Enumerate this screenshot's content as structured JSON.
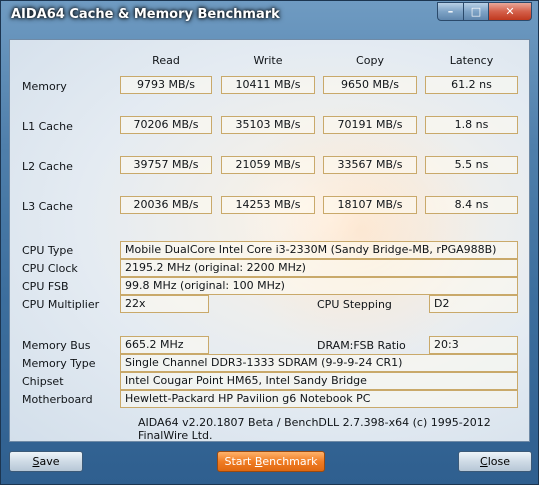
{
  "window": {
    "title": "AIDA64 Cache & Memory Benchmark",
    "controls": {
      "minimize": "–",
      "maximize": "□",
      "close": "✕"
    }
  },
  "headers": [
    "Read",
    "Write",
    "Copy",
    "Latency"
  ],
  "bench_rows": [
    {
      "label": "Memory",
      "read": "9793 MB/s",
      "write": "10411 MB/s",
      "copy": "9650 MB/s",
      "latency": "61.2 ns"
    },
    {
      "label": "L1 Cache",
      "read": "70206 MB/s",
      "write": "35103 MB/s",
      "copy": "70191 MB/s",
      "latency": "1.8 ns"
    },
    {
      "label": "L2 Cache",
      "read": "39757 MB/s",
      "write": "21059 MB/s",
      "copy": "33567 MB/s",
      "latency": "5.5 ns"
    },
    {
      "label": "L3 Cache",
      "read": "20036 MB/s",
      "write": "14253 MB/s",
      "copy": "18107 MB/s",
      "latency": "8.4 ns"
    }
  ],
  "cpu": {
    "type_label": "CPU Type",
    "type_value": "Mobile DualCore Intel Core i3-2330M  (Sandy Bridge-MB, rPGA988B)",
    "clock_label": "CPU Clock",
    "clock_value": "2195.2 MHz  (original: 2200 MHz)",
    "fsb_label": "CPU FSB",
    "fsb_value": "99.8 MHz  (original: 100 MHz)",
    "multiplier_label": "CPU Multiplier",
    "multiplier_value": "22x",
    "stepping_label": "CPU Stepping",
    "stepping_value": "D2"
  },
  "memory": {
    "bus_label": "Memory Bus",
    "bus_value": "665.2 MHz",
    "ratio_label": "DRAM:FSB Ratio",
    "ratio_value": "20:3",
    "type_label": "Memory Type",
    "type_value": "Single Channel DDR3-1333 SDRAM  (9-9-9-24 CR1)",
    "chipset_label": "Chipset",
    "chipset_value": "Intel Cougar Point HM65, Intel Sandy Bridge",
    "motherboard_label": "Motherboard",
    "motherboard_value": "Hewlett-Packard HP Pavilion g6 Notebook PC"
  },
  "footer": "AIDA64 v2.20.1807 Beta / BenchDLL 2.7.398-x64  (c) 1995-2012 FinalWire Ltd.",
  "buttons": {
    "save_first": "S",
    "save_rest": "ave",
    "start_pre": "Start ",
    "start_ul": "B",
    "start_rest": "enchmark",
    "close_first": "C",
    "close_rest": "lose"
  },
  "colors": {
    "accent": "#f07d25",
    "box_border": "#c9a96a",
    "frame": "#3d6f9e"
  }
}
